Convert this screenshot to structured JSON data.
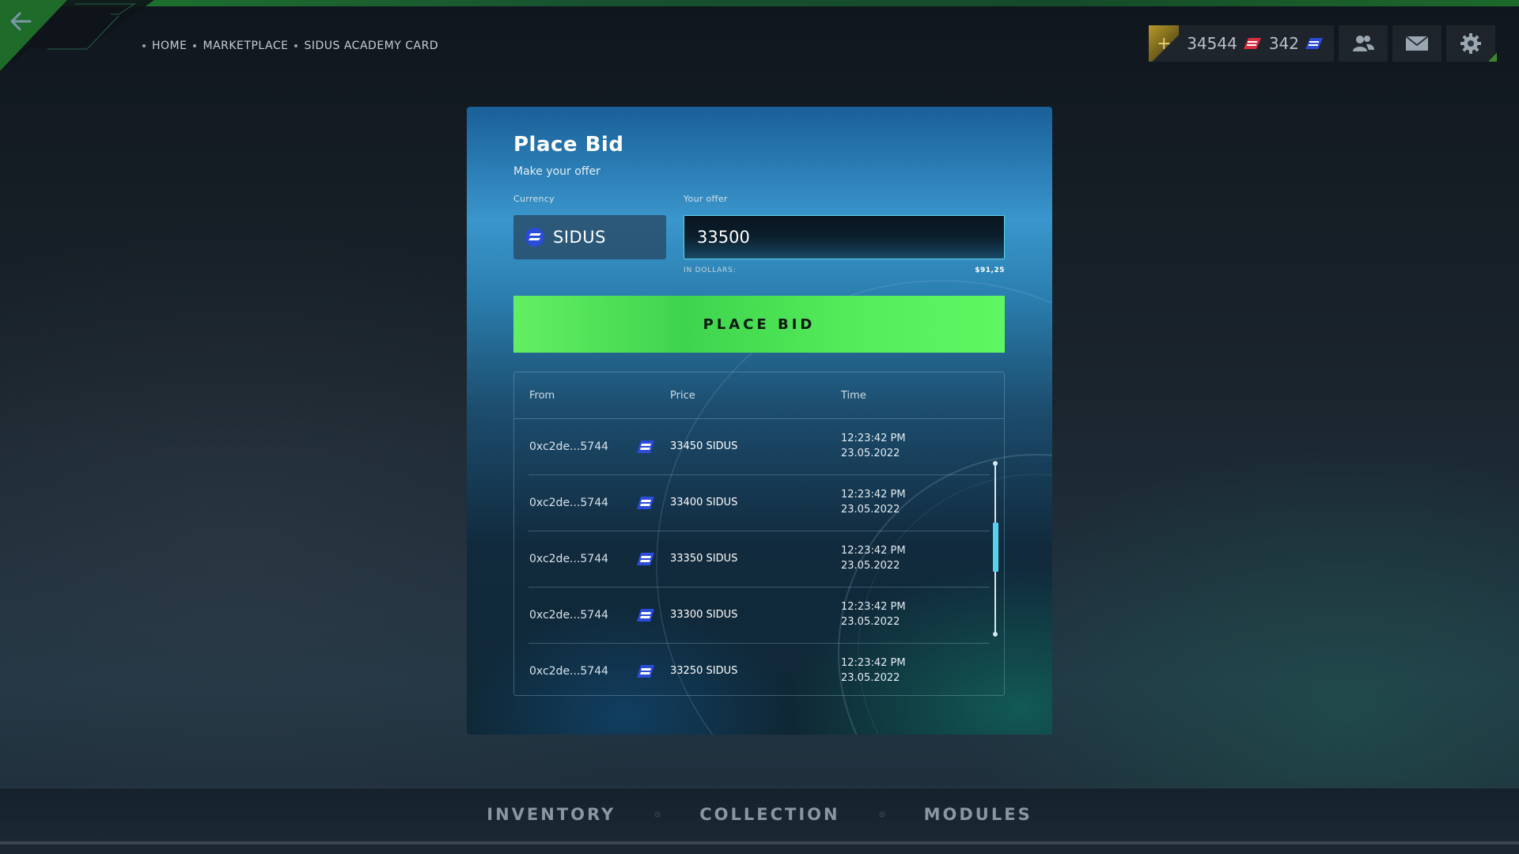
{
  "breadcrumb": {
    "items": [
      "HOME",
      "MARKETPLACE",
      "SIDUS ACADEMY CARD"
    ]
  },
  "resources": {
    "balance_primary": "34544",
    "balance_secondary": "342"
  },
  "modal": {
    "title": "Place Bid",
    "subtitle": "Make your offer",
    "currency_label": "Currency",
    "currency_value": "SIDUS",
    "offer_label": "Your offer",
    "offer_value": "33500",
    "in_dollars_label": "IN DOLLARS:",
    "in_dollars_value": "$91,25",
    "button_label": "PLACE BID",
    "table": {
      "headers": {
        "from": "From",
        "price": "Price",
        "time": "Time"
      },
      "rows": [
        {
          "from": "0xc2de...5744",
          "price": "33450 SIDUS",
          "time": "12:23:42 PM",
          "date": "23.05.2022"
        },
        {
          "from": "0xc2de...5744",
          "price": "33400 SIDUS",
          "time": "12:23:42 PM",
          "date": "23.05.2022"
        },
        {
          "from": "0xc2de...5744",
          "price": "33350 SIDUS",
          "time": "12:23:42 PM",
          "date": "23.05.2022"
        },
        {
          "from": "0xc2de...5744",
          "price": "33300 SIDUS",
          "time": "12:23:42 PM",
          "date": "23.05.2022"
        },
        {
          "from": "0xc2de...5744",
          "price": "33250 SIDUS",
          "time": "12:23:42 PM",
          "date": "23.05.2022"
        }
      ]
    }
  },
  "bottom_nav": {
    "tabs": [
      "INVENTORY",
      "COLLECTION",
      "MODULES"
    ]
  },
  "colors": {
    "accent_green": "#55ec5a",
    "accent_cyan": "#54d2ee",
    "currency_blue": "#2a4cd8",
    "currency_red": "#d83040"
  },
  "icons": {
    "back": "back-arrow-icon",
    "plus": "plus-icon",
    "coin_red": "red-coin-icon",
    "coin_blue": "sidus-coin-icon",
    "friends": "friends-icon",
    "mail": "mail-icon",
    "settings": "gear-icon"
  }
}
